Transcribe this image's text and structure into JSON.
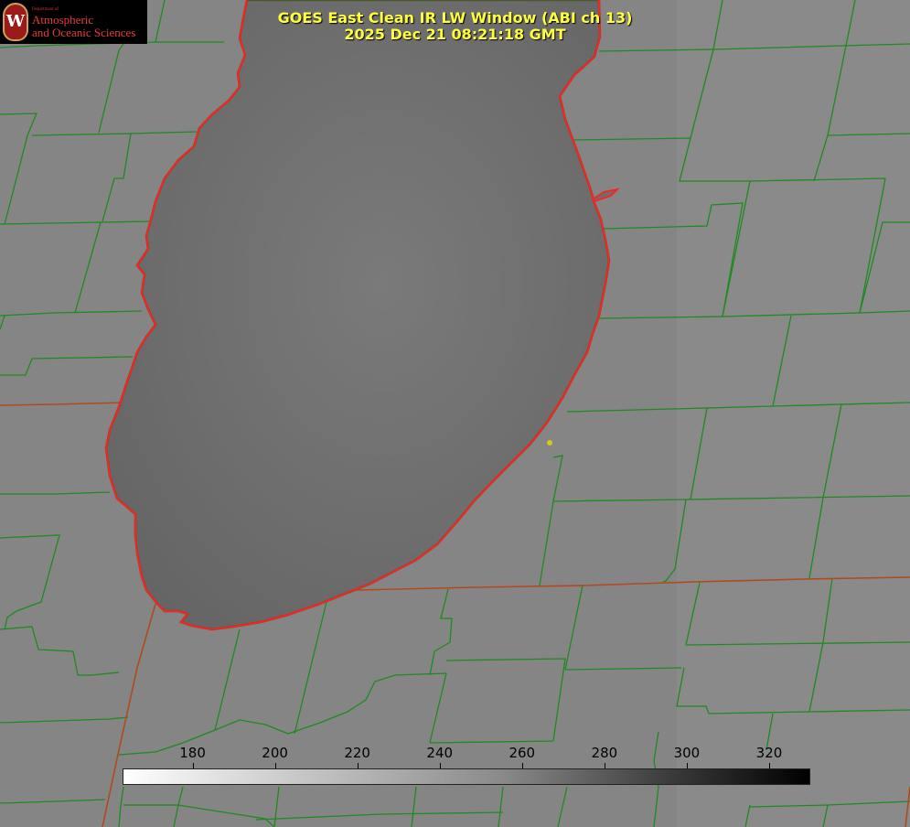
{
  "title": {
    "line1": "GOES East Clean IR LW Window (ABI ch 13)",
    "line2": "2025 Dec 21 08:21:18 GMT"
  },
  "logo": {
    "icon": "university-seal-icon",
    "department": "Department of",
    "line1": "Atmospheric",
    "line2": "and Oceanic Sciences"
  },
  "colorbar": {
    "ticks": [
      "180",
      "200",
      "220",
      "240",
      "260",
      "280",
      "300",
      "320"
    ],
    "min": 163,
    "max": 330
  },
  "colors": {
    "land": "#858585",
    "lake": "#6a6a6a",
    "county_lines": "#1f8a1f",
    "state_lines": "#b04a1e",
    "coastline": "#ff2020",
    "title_text": "#ffff3a"
  }
}
